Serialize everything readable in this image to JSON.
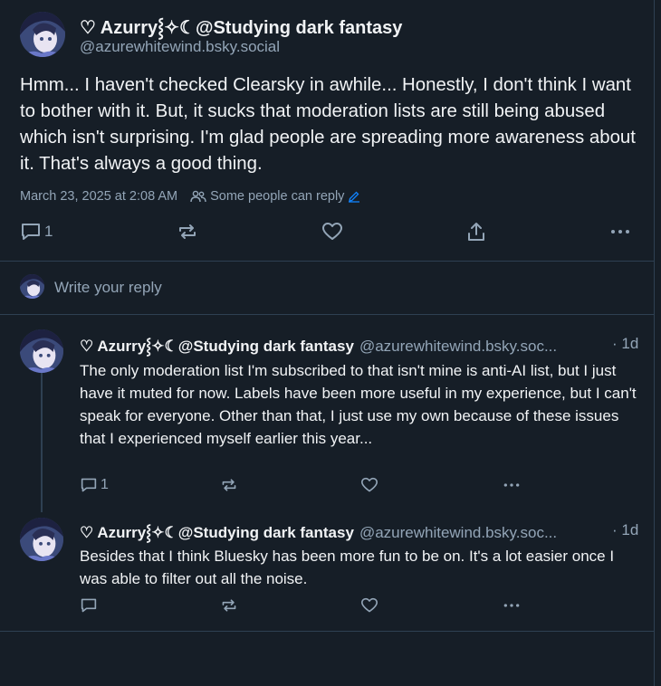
{
  "main_post": {
    "display_name": "♡ Azurry⸾✧☾@Studying dark fantasy",
    "handle": "@azurewhitewind.bsky.social",
    "text": "Hmm... I haven't checked Clearsky in awhile... Honestly, I don't think I want to bother with it. But, it sucks that moderation lists are still being abused which isn't surprising. I'm glad people are spreading more awareness about it. That's always a good thing.",
    "timestamp": "March 23, 2025 at 2:08 AM",
    "reply_setting": "Some people can reply",
    "reply_count": "1"
  },
  "write_reply": {
    "placeholder": "Write your reply"
  },
  "replies": [
    {
      "display_name": "♡ Azurry⸾✧☾@Studying dark fantasy",
      "handle": "@azurewhitewind.bsky.soc...",
      "time": "· 1d",
      "text": "The only moderation list I'm subscribed to that isn't mine is anti-AI list, but I just have it muted for now. Labels have been more useful in my experience, but I can't speak for everyone. Other than that, I just use my own because of these issues that I experienced myself earlier this year...",
      "reply_count": "1"
    },
    {
      "display_name": "♡ Azurry⸾✧☾@Studying dark fantasy",
      "handle": "@azurewhitewind.bsky.soc...",
      "time": "· 1d",
      "text": "Besides that I think Bluesky has been more fun to be on. It's a lot easier once I was able to filter out all the noise.",
      "reply_count": ""
    }
  ],
  "icons": {
    "reply": "reply-icon",
    "repost": "repost-icon",
    "like": "heart-icon",
    "share": "share-icon",
    "more": "more-icon",
    "people": "people-icon",
    "edit": "pencil-icon"
  },
  "colors": {
    "background": "#161e27",
    "border": "#2e4052",
    "text": "#f1f3f5",
    "muted": "#93a5b7",
    "accent": "#1083fe"
  }
}
